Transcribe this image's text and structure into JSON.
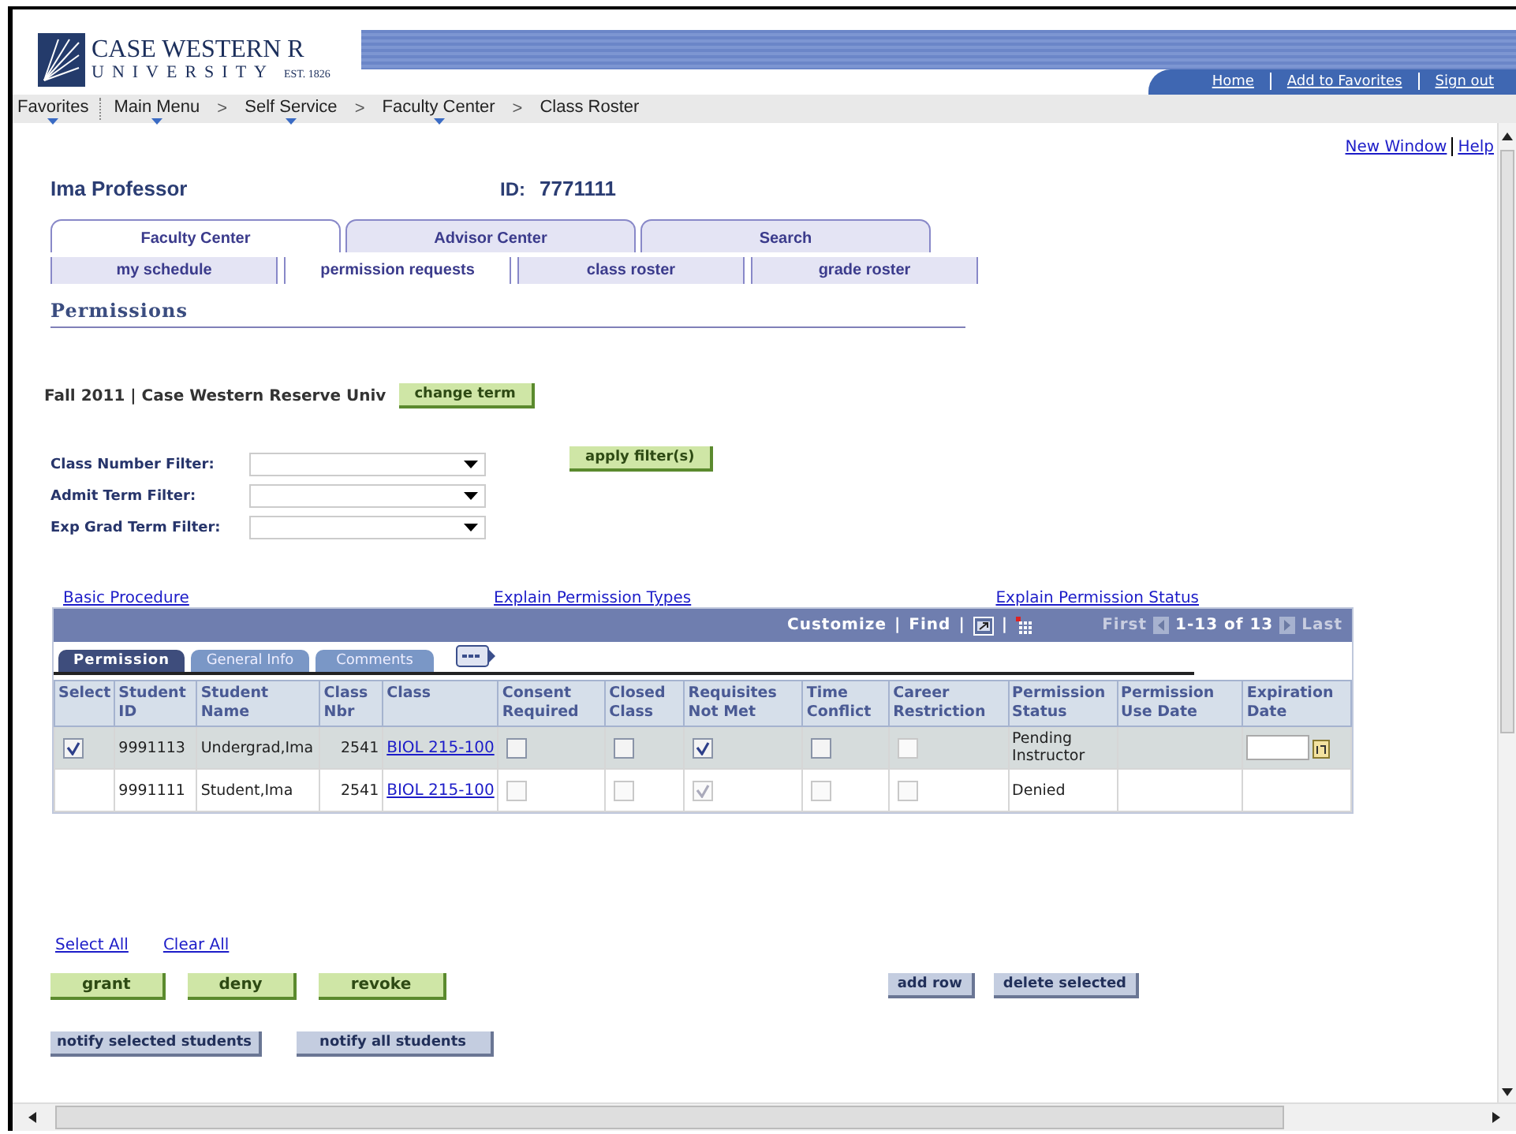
{
  "header": {
    "logo_name": "CASE WESTERN R",
    "logo_sub": "UNIVERSITY",
    "logo_est": "EST. 1826",
    "links": [
      "Home",
      "Add to Favorites",
      "Sign out"
    ]
  },
  "nav": {
    "items": [
      {
        "label": "Favorites",
        "menu": true
      },
      {
        "label": "Main Menu",
        "menu": true
      },
      {
        "label": "Self Service",
        "menu": true
      },
      {
        "label": "Faculty Center",
        "menu": true
      },
      {
        "label": "Class Roster",
        "menu": false
      }
    ],
    "separator": ">"
  },
  "top_links": [
    "New Window",
    "Help"
  ],
  "person": {
    "name": "Ima Professor",
    "id_label": "ID:",
    "id": "7771111"
  },
  "tabs": [
    {
      "label": "Faculty Center",
      "selected": true
    },
    {
      "label": "Advisor Center",
      "selected": false
    },
    {
      "label": "Search",
      "selected": false
    }
  ],
  "subtabs": [
    {
      "label": "my schedule",
      "selected": false
    },
    {
      "label": "permission requests",
      "selected": true
    },
    {
      "label": "class roster",
      "selected": false
    },
    {
      "label": "grade roster",
      "selected": false
    }
  ],
  "page_title": "Permissions",
  "term": {
    "text": "Fall 2011 | Case Western Reserve Univ",
    "button": "change term"
  },
  "filters": [
    {
      "label": "Class Number Filter:"
    },
    {
      "label": "Admit Term Filter:"
    },
    {
      "label": "Exp Grad Term Filter:"
    }
  ],
  "apply_button": "apply filter(s)",
  "help_links": [
    "Basic Procedure",
    "Explain Permission Types",
    "Explain Permission Status"
  ],
  "grid": {
    "toolbar": [
      "Customize",
      "|",
      "Find",
      "|"
    ],
    "nav": {
      "first": "First",
      "range": "1-13 of 13",
      "last": "Last"
    },
    "tabs": [
      {
        "label": "Permission",
        "selected": true
      },
      {
        "label": "General Info",
        "selected": false
      },
      {
        "label": "Comments",
        "selected": false
      }
    ],
    "columns": [
      "Select",
      "Student ID",
      "Student Name",
      "Class Nbr",
      "Class",
      "Consent Required",
      "Closed Class",
      "Requisites Not Met",
      "Time Conflict",
      "Career Restriction",
      "Permission Status",
      "Permission Use Date",
      "Expiration Date"
    ],
    "rows": [
      {
        "selected": true,
        "select": {
          "checked": true
        },
        "student_id": "9991113",
        "student_name": "Undergrad,Ima",
        "class_nbr": "2541",
        "class": "BIOL 215-100",
        "checks": [
          {
            "checked": false,
            "disabled": false
          },
          {
            "checked": false,
            "disabled": false
          },
          {
            "checked": true,
            "disabled": false
          },
          {
            "checked": false,
            "disabled": false
          },
          {
            "checked": false,
            "disabled": true
          }
        ],
        "status": "Pending Instructor",
        "date_editable": true
      },
      {
        "selected": false,
        "student_id": "9991111",
        "student_name": "Student,Ima",
        "class_nbr": "2541",
        "class": "BIOL 215-100",
        "checks": [
          {
            "checked": false,
            "disabled": true
          },
          {
            "checked": false,
            "disabled": true
          },
          {
            "checked": true,
            "disabled": true
          },
          {
            "checked": false,
            "disabled": true
          },
          {
            "checked": false,
            "disabled": true
          }
        ],
        "status": "Denied",
        "date_editable": false
      }
    ]
  },
  "select_links": [
    "Select All",
    "Clear All"
  ],
  "action_buttons": [
    {
      "label": "grant",
      "kind": "green"
    },
    {
      "label": "deny",
      "kind": "green"
    },
    {
      "label": "revoke",
      "kind": "green"
    }
  ],
  "row_buttons": [
    {
      "label": "add row",
      "kind": "blue"
    },
    {
      "label": "delete selected",
      "kind": "blue"
    }
  ],
  "notify_buttons": [
    {
      "label": "notify selected students",
      "kind": "blue"
    },
    {
      "label": "notify all students",
      "kind": "blue"
    }
  ]
}
